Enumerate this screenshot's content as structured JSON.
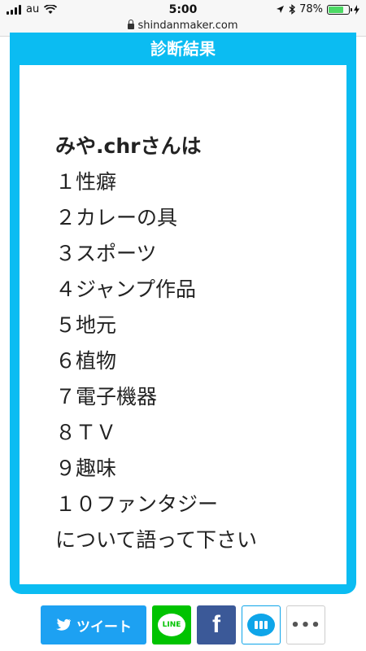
{
  "status_bar": {
    "carrier": "au",
    "time": "5:00",
    "battery_percent": "78%",
    "battery_level": 0.78
  },
  "url_bar": {
    "domain": "shindanmaker.com"
  },
  "result_card": {
    "title": "診断結果",
    "lines": [
      "みや.chrさんは",
      "１性癖",
      "２カレーの具",
      "３スポーツ",
      "４ジャンプ作品",
      "５地元",
      "６植物",
      "７電子機器",
      "８ＴＶ",
      "９趣味",
      "１０ファンタジー",
      "について語って下さい"
    ]
  },
  "share": {
    "tweet_label": "ツイート",
    "line_label": "LINE",
    "facebook_label": "f",
    "more_label": "•••",
    "colors": {
      "twitter": "#1da1f2",
      "line": "#00c300",
      "facebook": "#3b5998",
      "hatena": "#0ea5e9"
    }
  },
  "accent_color": "#0bbcf2"
}
